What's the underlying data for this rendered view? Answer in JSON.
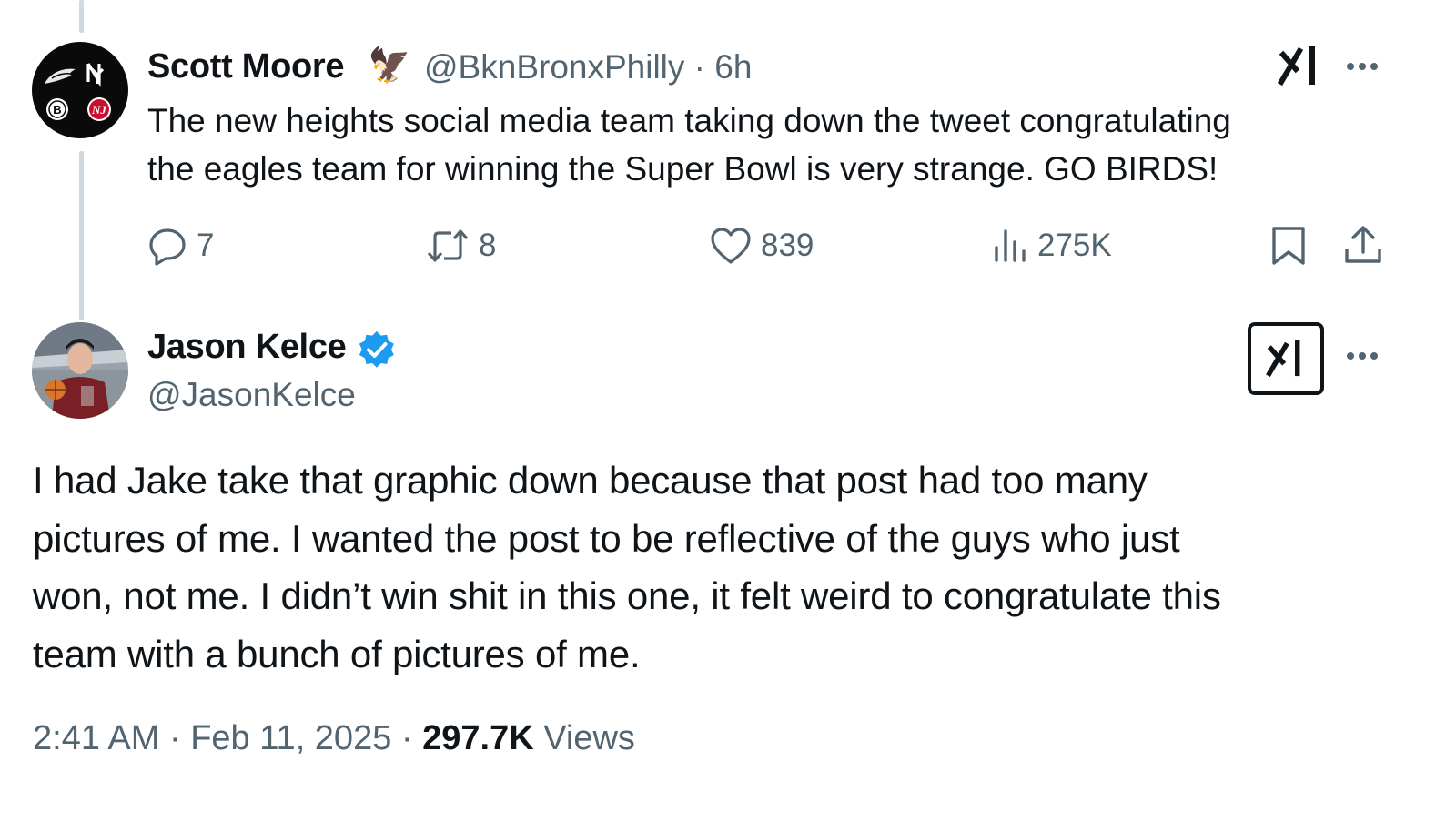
{
  "parent_tweet": {
    "author_name": "Scott Moore",
    "author_emoji": "🦅",
    "handle": "@BknBronxPhilly",
    "separator": "·",
    "time": "6h",
    "text_line1": "The new heights social media team taking down the tweet congratulating",
    "text_line2": "the eagles team for winning the Super Bowl is very strange. GO BIRDS!",
    "avatar_logos": [
      "eagles-logo",
      "yankees-logo",
      "nets-logo",
      "devils-logo"
    ],
    "actions": {
      "replies": "7",
      "reposts": "8",
      "likes": "839",
      "views": "275K"
    }
  },
  "main_tweet": {
    "author_name": "Jason Kelce",
    "verified": true,
    "handle": "@JasonKelce",
    "text_line1": "I had Jake take that graphic down because that post had too many",
    "text_line2": "pictures of me.  I wanted the post to be reflective of the guys who just",
    "text_line3": "won, not me.  I didn’t win shit in this one, it felt weird to congratulate this",
    "text_line4": "team with a bunch of pictures of me.",
    "time": "2:41 AM",
    "separator": "·",
    "date": "Feb 11, 2025",
    "views_count": "297.7K",
    "views_label": "Views"
  },
  "colors": {
    "text": "#0f1419",
    "secondary": "#536471",
    "verified": "#1d9bf0",
    "thread_line": "#cfd9de"
  },
  "icons": [
    "reply-icon",
    "repost-icon",
    "like-icon",
    "views-icon",
    "bookmark-icon",
    "share-icon",
    "grok-icon",
    "more-icon",
    "verified-badge-icon"
  ]
}
